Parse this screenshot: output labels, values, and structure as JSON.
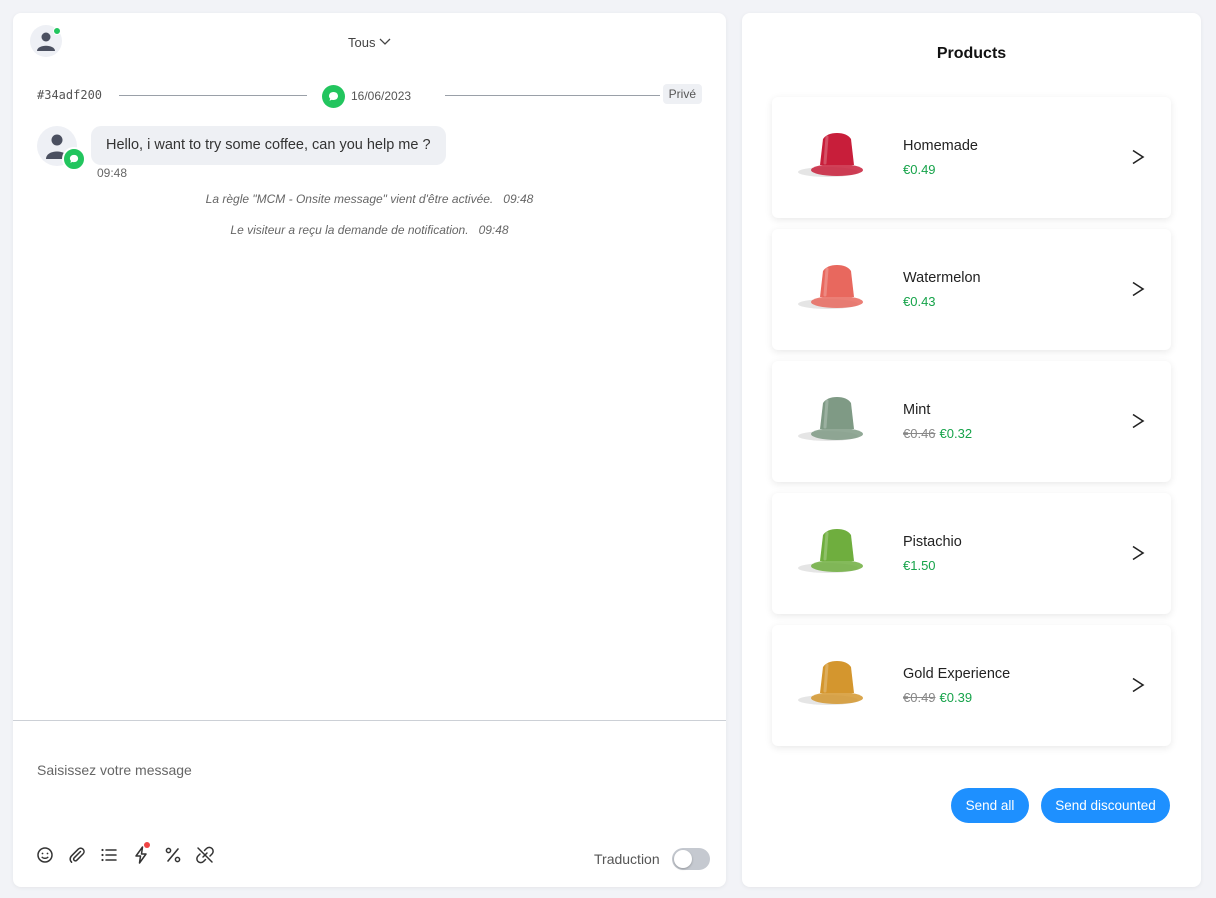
{
  "chat": {
    "filter_label": "Tous",
    "conversation_id": "#34adf200",
    "date": "16/06/2023",
    "visibility": "Privé",
    "message": {
      "text": "Hello, i want to try some coffee, can you help me ?",
      "time": "09:48"
    },
    "system_events": [
      {
        "text": "La règle \"MCM - Onsite message\" vient d'être activée.",
        "time": "09:48"
      },
      {
        "text": "Le visiteur a reçu la demande de notification.",
        "time": "09:48"
      }
    ],
    "composer_placeholder": "Saisissez votre message",
    "toolbar_icons": [
      "emoji-icon",
      "paperclip-icon",
      "list-icon",
      "lightning-icon",
      "percent-icon",
      "link-off-icon"
    ],
    "translation": {
      "label": "Traduction",
      "enabled": false
    }
  },
  "products": {
    "title": "Products",
    "items": [
      {
        "name": "Homemade",
        "price": "€0.49",
        "old_price": "",
        "color": "#c81e3a"
      },
      {
        "name": "Watermelon",
        "price": "€0.43",
        "old_price": "",
        "color": "#e8685e"
      },
      {
        "name": "Mint",
        "price": "€0.32",
        "old_price": "€0.46",
        "color": "#7f9a85"
      },
      {
        "name": "Pistachio",
        "price": "€1.50",
        "old_price": "",
        "color": "#6fae3e"
      },
      {
        "name": "Gold Experience",
        "price": "€0.39",
        "old_price": "€0.49",
        "color": "#d4962e"
      }
    ],
    "send_all_label": "Send all",
    "send_discounted_label": "Send discounted"
  },
  "colors": {
    "accent": "#1e90ff",
    "online": "#22c55e",
    "price": "#16a34a"
  }
}
